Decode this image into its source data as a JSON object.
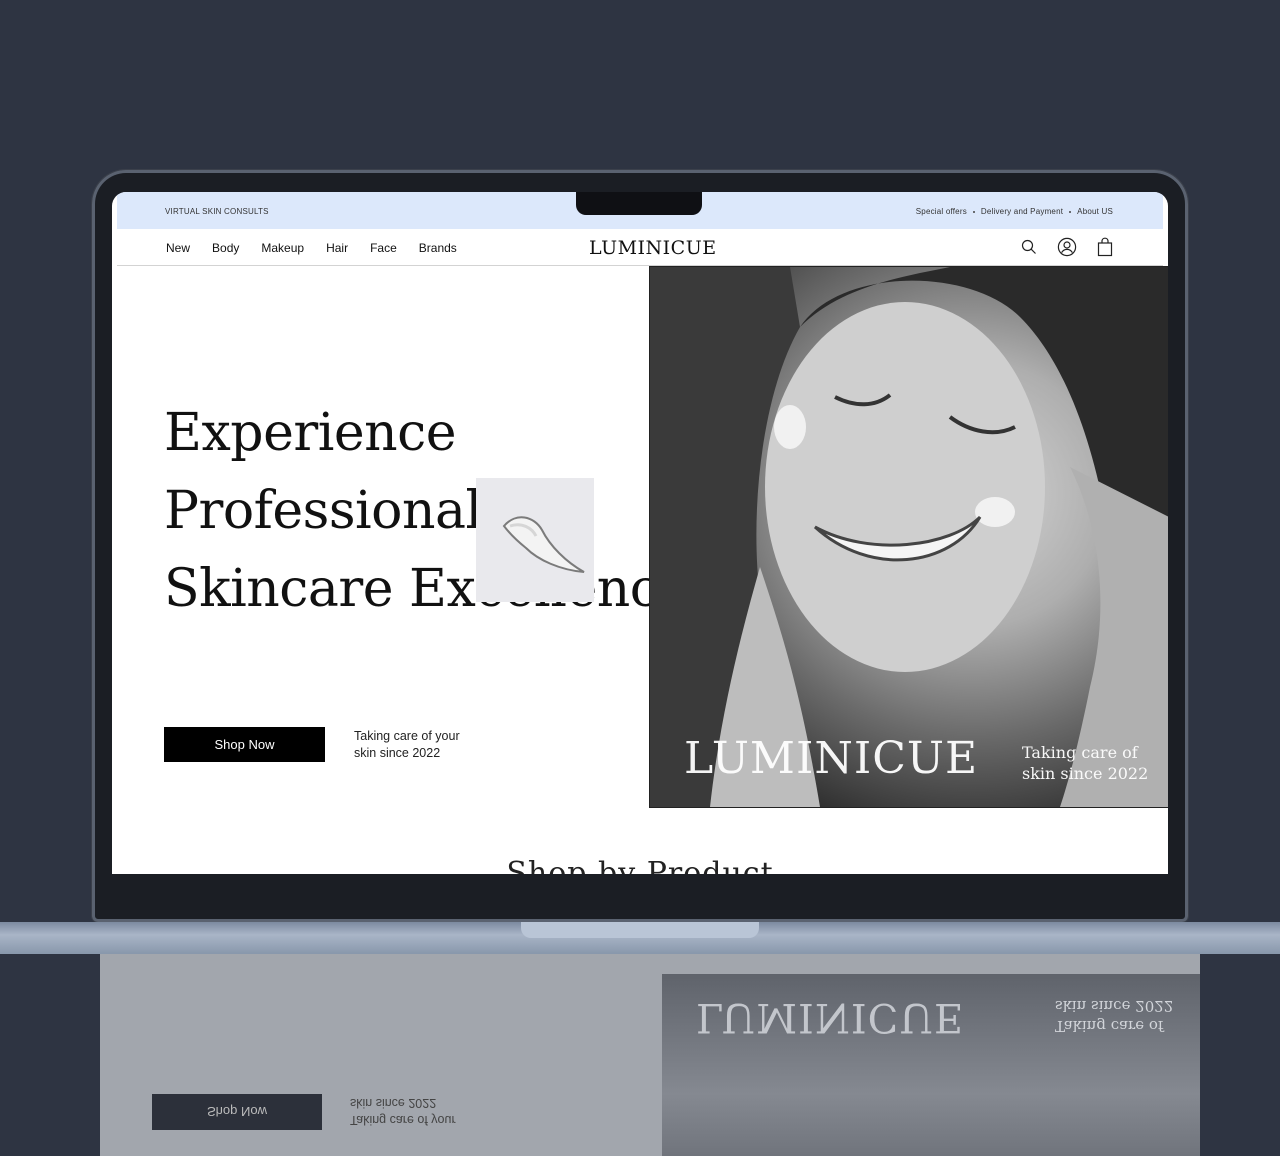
{
  "topbar": {
    "left_label": "VIRTUAL SKIN CONSULTS",
    "links": [
      "Special offers",
      "Delivery and Payment",
      "About US"
    ]
  },
  "nav": {
    "links": [
      "New",
      "Body",
      "Makeup",
      "Hair",
      "Face",
      "Brands"
    ],
    "logo": "LUMINICUE",
    "icons": [
      "search-icon",
      "account-icon",
      "bag-icon"
    ]
  },
  "hero": {
    "headline_lines": [
      "Experience",
      "Professional",
      "Skincare Excellence"
    ],
    "cta_label": "Shop Now",
    "tagline_line1": "Taking care of your",
    "tagline_line2": "skin since 2022",
    "image_logo": "LUMINICUE",
    "image_tag_line1": "Taking care of",
    "image_tag_line2": "skin since 2022"
  },
  "next_section": {
    "title": "Shop by Product"
  },
  "colors": {
    "background": "#2e3442",
    "topbar": "#dce8fb",
    "button": "#000000"
  }
}
